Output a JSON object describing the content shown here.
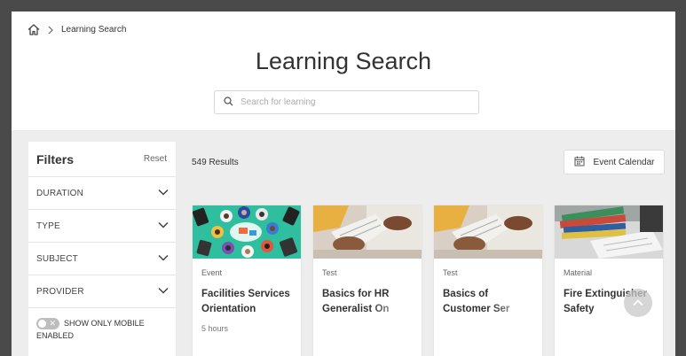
{
  "breadcrumb": {
    "current": "Learning Search"
  },
  "header": {
    "title": "Learning Search"
  },
  "search": {
    "placeholder": "Search for learning"
  },
  "filters": {
    "title": "Filters",
    "reset_label": "Reset",
    "items": [
      {
        "label": "DURATION"
      },
      {
        "label": "TYPE"
      },
      {
        "label": "SUBJECT"
      },
      {
        "label": "PROVIDER"
      }
    ],
    "mobile_toggle_label": "SHOW ONLY MOBILE ENABLED",
    "mobile_toggle_on": false
  },
  "results": {
    "count_label": "549 Results"
  },
  "event_calendar": {
    "label": "Event Calendar"
  },
  "cards": [
    {
      "type": "Event",
      "title": "Facilities Services Orientation",
      "meta": "5 hours"
    },
    {
      "type": "Test",
      "title": "Basics for HR Generalist On",
      "meta": ""
    },
    {
      "type": "Test",
      "title": "Basics of Customer Ser",
      "meta": ""
    },
    {
      "type": "Material",
      "title": "Fire Extinguisher Safety",
      "meta": ""
    }
  ],
  "colors": {
    "accent_teal": "#2fbf9f",
    "frame_border": "#4a4a4a",
    "page_bg": "#ededed"
  },
  "icons": {
    "home": "home-icon",
    "chevron": "chevron-down-icon",
    "calendar": "calendar-icon",
    "search": "search-icon",
    "scroll_top": "chevron-up-icon"
  }
}
